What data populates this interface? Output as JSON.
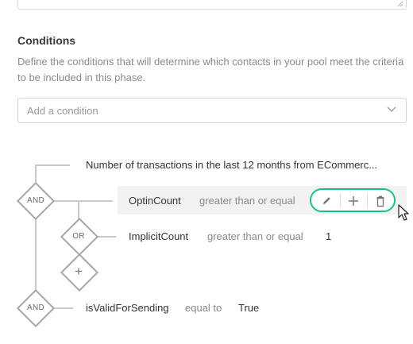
{
  "conditions": {
    "title": "Conditions",
    "description": "Define the conditions that will determine which contacts in your pool meet the criteria to be included in this phase.",
    "add_condition_placeholder": "Add a condition"
  },
  "tree": {
    "root_text": "Number of transactions in the last 12 months from ECommerc...",
    "and_label_1": "AND",
    "optin": {
      "field": "OptinCount",
      "operator": "greater than or equal"
    },
    "or_label": "OR",
    "implicit": {
      "field": "ImplicitCount",
      "operator": "greater than or equal",
      "value": "1"
    },
    "add_symbol": "+",
    "and_label_2": "AND",
    "valid": {
      "field": "isValidForSending",
      "operator": "equal to",
      "value": "True"
    }
  },
  "colors": {
    "accent_green": "#18c27a",
    "line_gray": "#c9c9c9",
    "highlight_bg": "#f2f2f2"
  },
  "icons": {
    "edit": "pencil-icon",
    "add": "plus-icon",
    "delete": "trash-icon",
    "dropdown": "chevron-down-icon"
  }
}
